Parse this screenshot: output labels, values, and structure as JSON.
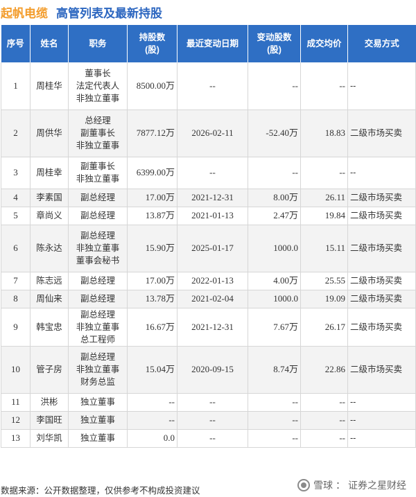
{
  "title": {
    "company": "起帆电缆",
    "subtitle": "高管列表及最新持股"
  },
  "table": {
    "headers": {
      "seq": "序号",
      "name": "姓名",
      "position": "职务",
      "shares_l1": "持股数",
      "shares_l2": "(股)",
      "date": "最近变动日期",
      "change_l1": "变动股数",
      "change_l2": "(股)",
      "price": "成交均价",
      "method": "交易方式"
    },
    "rows": [
      {
        "seq": "1",
        "name": "周桂华",
        "positions": [
          "董事长",
          "法定代表人",
          "非独立董事"
        ],
        "shares": "8500.00万",
        "date": "--",
        "change": "--",
        "price": "--",
        "method": "--"
      },
      {
        "seq": "2",
        "name": "周供华",
        "positions": [
          "总经理",
          "副董事长",
          "非独立董事"
        ],
        "shares": "7877.12万",
        "date": "2026-02-11",
        "change": "-52.40万",
        "price": "18.83",
        "method": "二级市场买卖"
      },
      {
        "seq": "3",
        "name": "周桂幸",
        "positions": [
          "副董事长",
          "非独立董事"
        ],
        "shares": "6399.00万",
        "date": "--",
        "change": "--",
        "price": "--",
        "method": "--"
      },
      {
        "seq": "4",
        "name": "李素国",
        "positions": [
          "副总经理"
        ],
        "shares": "17.00万",
        "date": "2021-12-31",
        "change": "8.00万",
        "price": "26.11",
        "method": "二级市场买卖"
      },
      {
        "seq": "5",
        "name": "章尚义",
        "positions": [
          "副总经理"
        ],
        "shares": "13.87万",
        "date": "2021-01-13",
        "change": "2.47万",
        "price": "19.84",
        "method": "二级市场买卖"
      },
      {
        "seq": "6",
        "name": "陈永达",
        "positions": [
          "副总经理",
          "非独立董事",
          "董事会秘书"
        ],
        "shares": "15.90万",
        "date": "2025-01-17",
        "change": "1000.0",
        "price": "15.11",
        "method": "二级市场买卖"
      },
      {
        "seq": "7",
        "name": "陈志远",
        "positions": [
          "副总经理"
        ],
        "shares": "17.00万",
        "date": "2022-01-13",
        "change": "4.00万",
        "price": "25.55",
        "method": "二级市场买卖"
      },
      {
        "seq": "8",
        "name": "周仙来",
        "positions": [
          "副总经理"
        ],
        "shares": "13.78万",
        "date": "2021-02-04",
        "change": "1000.0",
        "price": "19.09",
        "method": "二级市场买卖"
      },
      {
        "seq": "9",
        "name": "韩宝忠",
        "positions": [
          "副总经理",
          "非独立董事",
          "总工程师"
        ],
        "shares": "16.67万",
        "date": "2021-12-31",
        "change": "7.67万",
        "price": "26.17",
        "method": "二级市场买卖"
      },
      {
        "seq": "10",
        "name": "管子房",
        "positions": [
          "副总经理",
          "非独立董事",
          "财务总监"
        ],
        "shares": "15.04万",
        "date": "2020-09-15",
        "change": "8.74万",
        "price": "22.86",
        "method": "二级市场买卖"
      },
      {
        "seq": "11",
        "name": "洪彬",
        "positions": [
          "独立董事"
        ],
        "shares": "--",
        "date": "--",
        "change": "--",
        "price": "--",
        "method": "--"
      },
      {
        "seq": "12",
        "name": "李国旺",
        "positions": [
          "独立董事"
        ],
        "shares": "--",
        "date": "--",
        "change": "--",
        "price": "--",
        "method": "--"
      },
      {
        "seq": "13",
        "name": "刘华凯",
        "positions": [
          "独立董事"
        ],
        "shares": "0.0",
        "date": "--",
        "change": "--",
        "price": "--",
        "method": "--"
      }
    ]
  },
  "footer": {
    "source": "数据来源：公开数据整理，仅供参考不构成投资建议"
  },
  "brand": {
    "platform": "雪球",
    "separator": "：",
    "account": "证券之星财经"
  },
  "colors": {
    "header_bg": "#2f6fc4",
    "company": "#f39c2b",
    "subtitle": "#2c66c0",
    "up": "#e0202e",
    "down": "#1e9e3e"
  }
}
